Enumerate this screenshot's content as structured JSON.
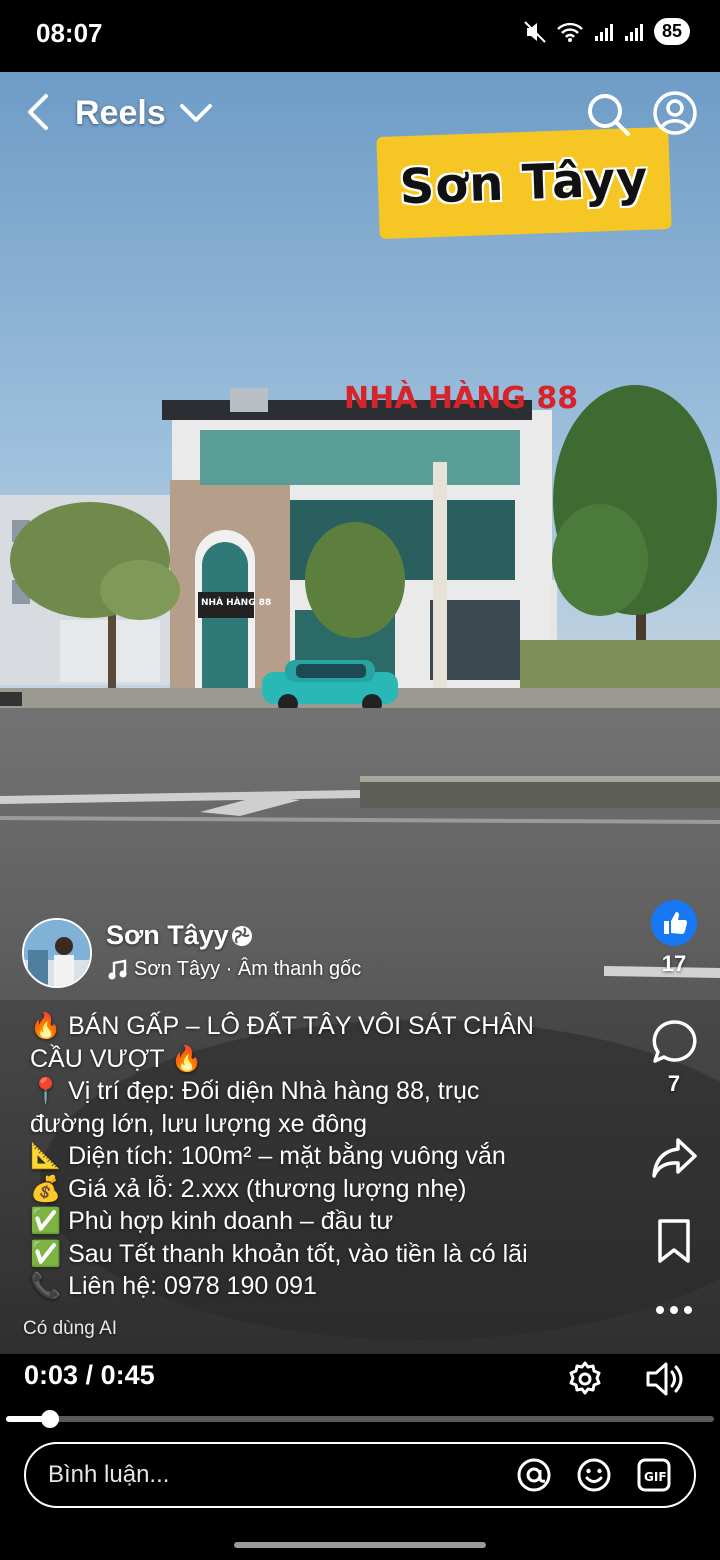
{
  "status": {
    "time": "08:07",
    "battery": "85",
    "icons": [
      "mute-icon",
      "wifi-icon",
      "signal-icon",
      "signal-icon"
    ]
  },
  "header": {
    "back_icon": "chevron-left-icon",
    "title": "Reels",
    "title_icon": "chevron-down-icon",
    "search_icon": "search-icon",
    "profile_icon": "profile-icon"
  },
  "video": {
    "overlay_text": "Sơn Tâyy",
    "restaurant_sign": "NHÀ HÀNG 88",
    "door_sign": "NHÀ HÀNG 88"
  },
  "author": {
    "name": "Sơn Tâyy",
    "visibility_icon": "globe-icon",
    "audio_icon": "music-note-icon",
    "audio": "Sơn Tâyy · Âm thanh gốc"
  },
  "caption": {
    "lines": [
      "🔥 BÁN GẤP – LÔ ĐẤT TÂY VÔI SÁT CHÂN",
      "CẦU VƯỢT 🔥",
      "📍 Vị trí đẹp: Đối diện Nhà hàng 88, trục",
      "đường lớn, lưu lượng xe đông",
      "📐 Diện tích: 100m² – mặt bằng vuông vắn",
      "💰 Giá xả lỗ: 2.xxx (thương lượng nhẹ)",
      "✅ Phù hợp kinh doanh – đầu tư",
      "✅ Sau Tết thanh khoản tốt, vào tiền là có lãi",
      "📞 Liên hệ: 0978 190 091"
    ],
    "ai_label": "Có dùng AI"
  },
  "actions": {
    "like_count": "17",
    "comment_count": "7",
    "icons": [
      "like-icon",
      "comment-icon",
      "share-icon",
      "bookmark-icon",
      "more-icon"
    ]
  },
  "player": {
    "current": "0:03",
    "separator": " / ",
    "duration": "0:45",
    "progress": 0.062,
    "settings_icon": "gear-icon",
    "volume_icon": "volume-icon"
  },
  "comment": {
    "placeholder": "Bình luận...",
    "icons": [
      "mention-icon",
      "emoji-icon",
      "gif-icon"
    ]
  },
  "colors": {
    "like": "#1877f2",
    "overlay_tag": "#f6c624",
    "sign_red": "#d6242b"
  }
}
